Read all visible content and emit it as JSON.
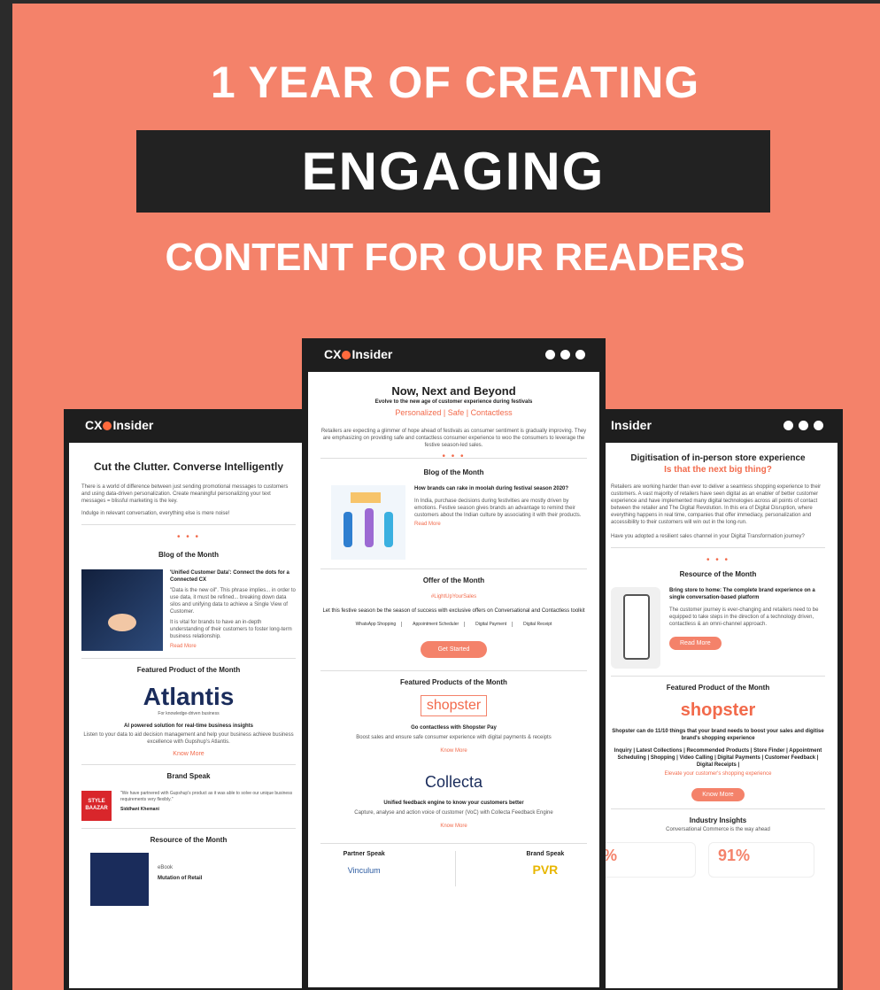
{
  "poster": {
    "line1": "1 YEAR OF CREATING",
    "line2": "ENGAGING",
    "line3": "CONTENT FOR OUR READERS"
  },
  "logo_left": "CX",
  "logo_right": "Insider",
  "left": {
    "headline": "Cut the Clutter. Converse Intelligently",
    "intro": "There is a world of difference between just sending promotional messages to customers and using data-driven personalization. Create meaningful personalizing your text messages = blissful marketing is the key.",
    "tagline": "Indulge in relevant conversation, everything else is mere noise!",
    "blog_title": "Blog of the Month",
    "blog_heading": "'Unified Customer Data': Connect the dots for a Connected CX",
    "blog_body": "\"Data is the new oil\". This phrase implies... in order to use data, it must be refined... breaking down data silos and unifying data to achieve a Single View of Customer.",
    "blog_body2": "It is vital for brands to have an in-depth understanding of their customers to foster long-term business relationship.",
    "read_more": "Read More",
    "featured_title": "Featured Product of the Month",
    "product_name": "Atlantis",
    "product_sub": "For knowledge-driven business",
    "product_desc": "AI powered solution for real-time business insights",
    "product_body": "Listen to your data to aid decision management and help your business achieve business excellence with Gupshup's Atlantis.",
    "know_more": "Know More",
    "brand_title": "Brand Speak",
    "brand_logo": "STYLE BAAZAR",
    "brand_quote": "\"We have partnered with Gupshup's product as it was able to solve our unique business requirements very flexibly.\"",
    "brand_person": "Siddhant Khemani",
    "resource_title": "Resource of the Month",
    "resource_label": "eBook",
    "resource_heading": "Mutation of Retail"
  },
  "center": {
    "headline": "Now, Next and Beyond",
    "sub": "Evolve to the new age of customer experience during festivals",
    "tagline": "Personalized | Safe | Contactless",
    "intro": "Retailers are expecting a glimmer of hope ahead of festivals as consumer sentiment is gradually improving. They are emphasizing on providing safe and contactless consumer experience to woo the consumers to leverage the festive season-led sales.",
    "blog_title": "Blog of the Month",
    "blog_heading": "How brands can rake in moolah during festival season 2020?",
    "blog_body": "In India, purchase decisions during festivities are mostly driven by emotions. Festive season gives brands an advantage to remind their customers about the Indian culture by associating it with their products.",
    "read_more": "Read More",
    "offer_title": "Offer of the Month",
    "offer_tag": "#LightUpYourSales",
    "offer_body": "Let this festive season be the season of success with exclusive offers on Conversational and Contactless toolkit",
    "offer_items": [
      "WhatsApp Shopping",
      "Appointment Scheduler",
      "Digital Payment",
      "Digital Receipt"
    ],
    "cta": "Get Started",
    "featured_title": "Featured Products of the Month",
    "product1": "shopster",
    "product1_desc": "Go contactless with Shopster Pay",
    "product1_body": "Boost sales and ensure safe consumer experience with digital payments & receipts",
    "know_more": "Know More",
    "product2": "Collecta",
    "product2_desc": "Unified feedback engine to know your customers better",
    "product2_body": "Capture, analyse and action voice of customer (VoC) with Collecta Feedback Engine",
    "partner_title": "Partner Speak",
    "brand_title": "Brand Speak",
    "partner_logo": "Vinculum",
    "brand_logo": "PVR"
  },
  "right": {
    "headline": "Digitisation of in-person store experience",
    "sub": "Is that the next big thing?",
    "intro": "Retailers are working harder than ever to deliver a seamless shopping experience to their customers. A vast majority of retailers have seen digital as an enabler of better customer experience and have implemented many digital technologies across all points of contact between the retailer and The Digital Revolution. In this era of Digital Disruption, where everything happens in real time, companies that offer immediacy, personalization and accessibility to their customers will win out in the long-run.",
    "question": "Have you adopted a resilient sales channel in your Digital Transformation journey?",
    "resource_title": "Resource of the Month",
    "resource_heading": "Bring store to home: The complete brand experience on a single conversation-based platform",
    "resource_body": "The customer journey is ever-changing and retailers need to be equipped to take steps in the direction of a technology driven, contactless & an omni-channel approach.",
    "read_more": "Read More",
    "featured_title": "Featured Product of the Month",
    "product": "shopster",
    "product_desc": "Shopster can do 11/10 things that your brand needs to boost your sales and digitise brand's shopping experience",
    "product_list": "Inquiry | Latest Collections | Recommended Products | Store Finder | Appointment Scheduling | Shopping | Video Calling | Digital Payments | Customer Feedback | Digital Receipts |",
    "product_cta_text": "Elevate your customer's shopping experience",
    "know_more": "Know More",
    "insights_title": "Industry Insights",
    "insights_sub": "Conversational Commerce is the way ahead",
    "stat1": "%",
    "stat2": "91%"
  }
}
